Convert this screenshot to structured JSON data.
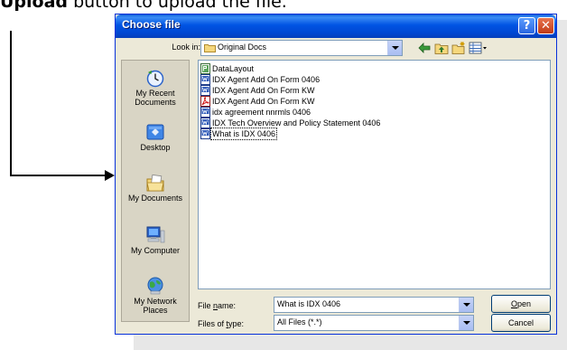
{
  "caption": {
    "bold": "Upload",
    "rest": " button to upload the file."
  },
  "dialog": {
    "title": "Choose file",
    "help_glyph": "?",
    "close_glyph": "✕",
    "look_in_label": "Look in:",
    "look_in_value": "Original Docs",
    "places": [
      {
        "label": "My Recent Documents"
      },
      {
        "label": "Desktop"
      },
      {
        "label": "My Documents"
      },
      {
        "label": "My Computer"
      },
      {
        "label": "My Network Places"
      }
    ],
    "files": [
      {
        "name": "DataLayout",
        "icon": "publisher-file-icon"
      },
      {
        "name": "IDX Agent Add On Form 0406",
        "icon": "word-file-icon"
      },
      {
        "name": "IDX Agent Add On Form KW",
        "icon": "word-file-icon"
      },
      {
        "name": "IDX Agent Add On Form KW",
        "icon": "pdf-file-icon"
      },
      {
        "name": "idx agreement nnrmls 0406",
        "icon": "word-file-icon"
      },
      {
        "name": "IDX Tech Overview and Policy Statement 0406",
        "icon": "word-file-icon"
      },
      {
        "name": "What is IDX 0406",
        "icon": "word-file-icon"
      }
    ],
    "file_name_label_pre": "File ",
    "file_name_label_key": "n",
    "file_name_label_post": "ame:",
    "file_name_value": "What is IDX 0406",
    "file_type_label_pre": "Files of ",
    "file_type_label_key": "t",
    "file_type_label_post": "ype:",
    "file_type_value": "All Files (*.*)",
    "open_key": "O",
    "open_rest": "pen",
    "cancel_label": "Cancel"
  },
  "colors": {
    "titlebar": "#0054e3",
    "dialog_bg": "#ece9d8",
    "places_bg": "#d9d5c5"
  }
}
